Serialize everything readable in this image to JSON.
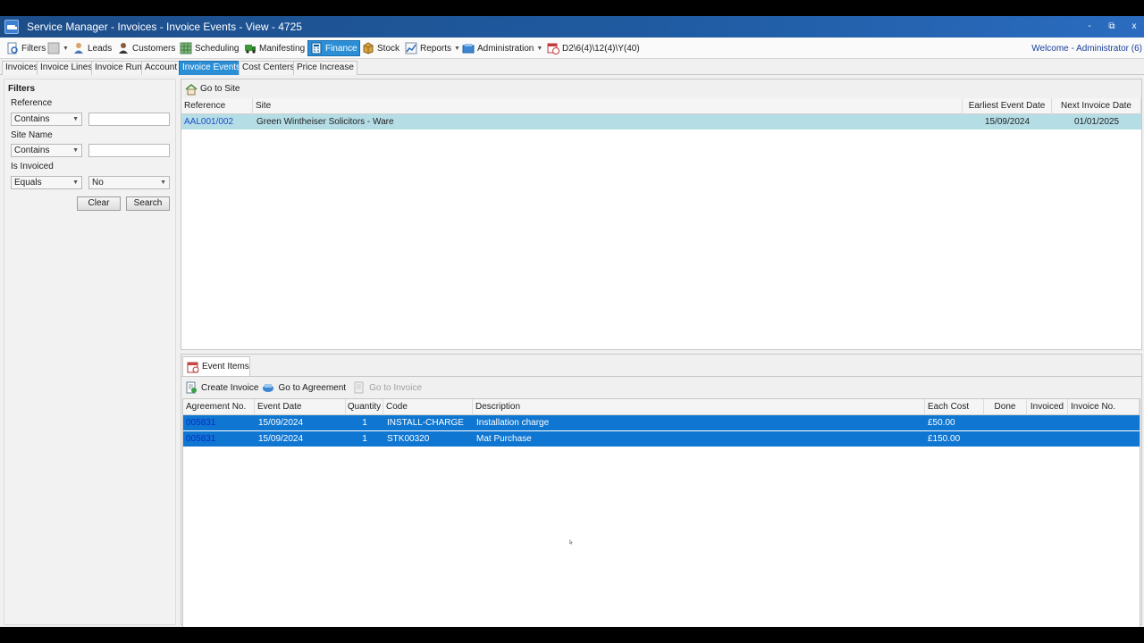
{
  "window": {
    "title": "Service Manager - Invoices - Invoice Events - View - 4725",
    "min_label": "-",
    "restore_label": "⧉",
    "close_label": "x"
  },
  "toolbar": {
    "filters": "Filters",
    "leads": "Leads",
    "customers": "Customers",
    "scheduling": "Scheduling",
    "manifesting": "Manifesting",
    "finance": "Finance",
    "stock": "Stock",
    "reports": "Reports",
    "administration": "Administration",
    "date_format": "D2\\6(4)\\12(4)\\Y(40)",
    "welcome": "Welcome - Administrator (6)"
  },
  "tabs": [
    "Invoices",
    "Invoice Lines",
    "Invoice Run",
    "Account",
    "Invoice Events",
    "Cost Centers",
    "Price Increase"
  ],
  "filters": {
    "header": "Filters",
    "reference_label": "Reference",
    "reference_op": "Contains",
    "reference_value": "",
    "site_label": "Site Name",
    "site_op": "Contains",
    "site_value": "",
    "invoiced_label": "Is Invoiced",
    "invoiced_op": "Equals",
    "invoiced_value": "No",
    "clear": "Clear",
    "search": "Search"
  },
  "sites": {
    "go_to_site": "Go to Site",
    "columns": [
      "Reference",
      "Site",
      "Earliest Event Date",
      "Next Invoice Date"
    ],
    "rows": [
      {
        "reference": "AAL001/002",
        "site": "Green Wintheiser Solicitors - Ware",
        "earliest": "15/09/2024",
        "next": "01/01/2025"
      }
    ]
  },
  "events": {
    "tab_label": "Event Items",
    "create_invoice": "Create Invoice",
    "go_to_agreement": "Go to Agreement",
    "go_to_invoice": "Go to Invoice",
    "columns": [
      "Agreement No.",
      "Event Date",
      "Quantity",
      "Code",
      "Description",
      "Each Cost",
      "Done",
      "Invoiced",
      "Invoice No."
    ],
    "rows": [
      {
        "agreement": "005831",
        "date": "15/09/2024",
        "qty": "1",
        "code": "INSTALL-CHARGE",
        "desc": "Installation charge",
        "cost": "£50.00"
      },
      {
        "agreement": "005831",
        "date": "15/09/2024",
        "qty": "1",
        "code": "STK00320",
        "desc": "Mat Purchase",
        "cost": "£150.00"
      }
    ]
  }
}
